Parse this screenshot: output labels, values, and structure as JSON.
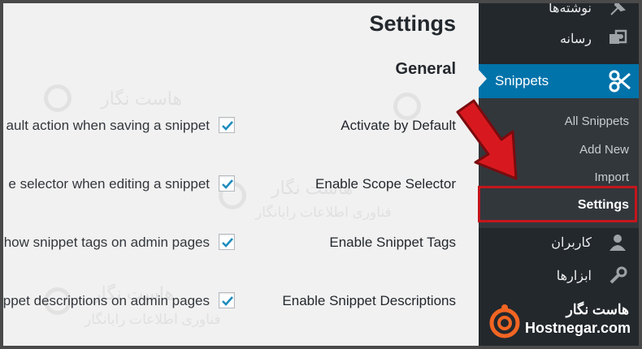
{
  "header": {
    "title": "Settings",
    "section": "General"
  },
  "settings_rows": [
    {
      "label": "Activate by Default",
      "description": "ault action when saving a snippet",
      "checked": true
    },
    {
      "label": "Enable Scope Selector",
      "description": "e selector when editing a snippet",
      "checked": true
    },
    {
      "label": "Enable Snippet Tags",
      "description": "how snippet tags on admin pages",
      "checked": true
    },
    {
      "label": "Enable Snippet Descriptions",
      "description": "ppet descriptions on admin pages",
      "checked": true
    }
  ],
  "watermarks": {
    "name": "هاست نگار",
    "tagline": "فناوری اطلاعات رایانگار"
  },
  "sidebar": {
    "top_items": [
      {
        "label": "نوشته‌ها",
        "icon": "pin-icon"
      },
      {
        "label": "رسانه",
        "icon": "media-icon"
      }
    ],
    "active": {
      "label": "Snippets",
      "icon": "scissors-icon"
    },
    "submenu": [
      {
        "label": "All Snippets",
        "current": false
      },
      {
        "label": "Add New",
        "current": false
      },
      {
        "label": "Import",
        "current": false
      },
      {
        "label": "Settings",
        "current": true
      }
    ],
    "bottom_items": [
      {
        "label": "کاربران",
        "icon": "user-icon"
      },
      {
        "label": "ابزارها",
        "icon": "wrench-icon"
      }
    ]
  },
  "brand": {
    "name": "هاست نگار",
    "url": "Hostnegar.com"
  },
  "colors": {
    "active_menu": "#0073aa",
    "highlight": "#c4161c",
    "arrow": "#d7191f",
    "brand_logo": "#f26522"
  }
}
